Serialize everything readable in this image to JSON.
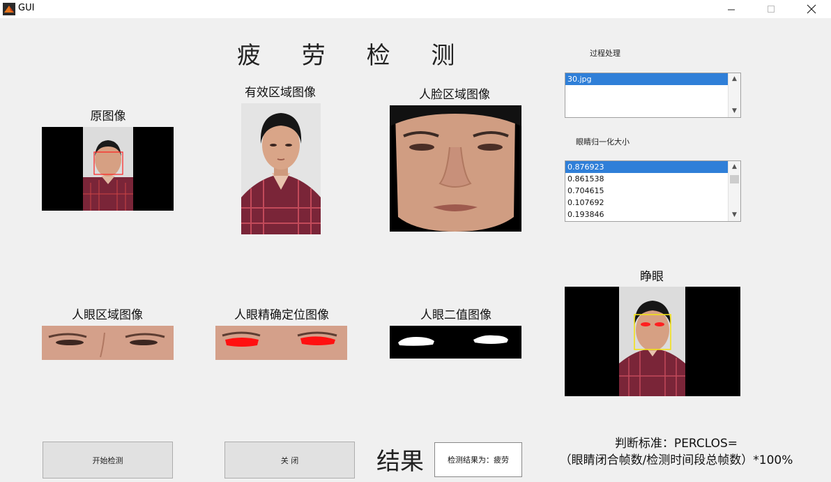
{
  "window": {
    "title": "GUI"
  },
  "main_title": "疲 劳 检 测",
  "labels": {
    "original": "原图像",
    "valid_region": "有效区域图像",
    "face_region": "人脸区域图像",
    "eye_region": "人眼区域图像",
    "eye_precise": "人眼精确定位图像",
    "eye_binary": "人眼二值图像",
    "eye_state": "睁眼",
    "process": "过程处理",
    "eye_norm": "眼睛归一化大小"
  },
  "process_list": {
    "items": [
      "30.jpg"
    ],
    "selected": 0
  },
  "norm_list": {
    "items": [
      "0.876923",
      "0.861538",
      "0.704615",
      "0.107692",
      "0.193846"
    ],
    "selected": 0
  },
  "buttons": {
    "start": "开始检测",
    "close": "关  闭"
  },
  "result": {
    "label": "结果",
    "value": "检测结果为：疲劳"
  },
  "criteria": {
    "line1": "判断标准：PERCLOS=",
    "line2": "（眼睛闭合帧数/检测时间段总帧数）*100%"
  }
}
